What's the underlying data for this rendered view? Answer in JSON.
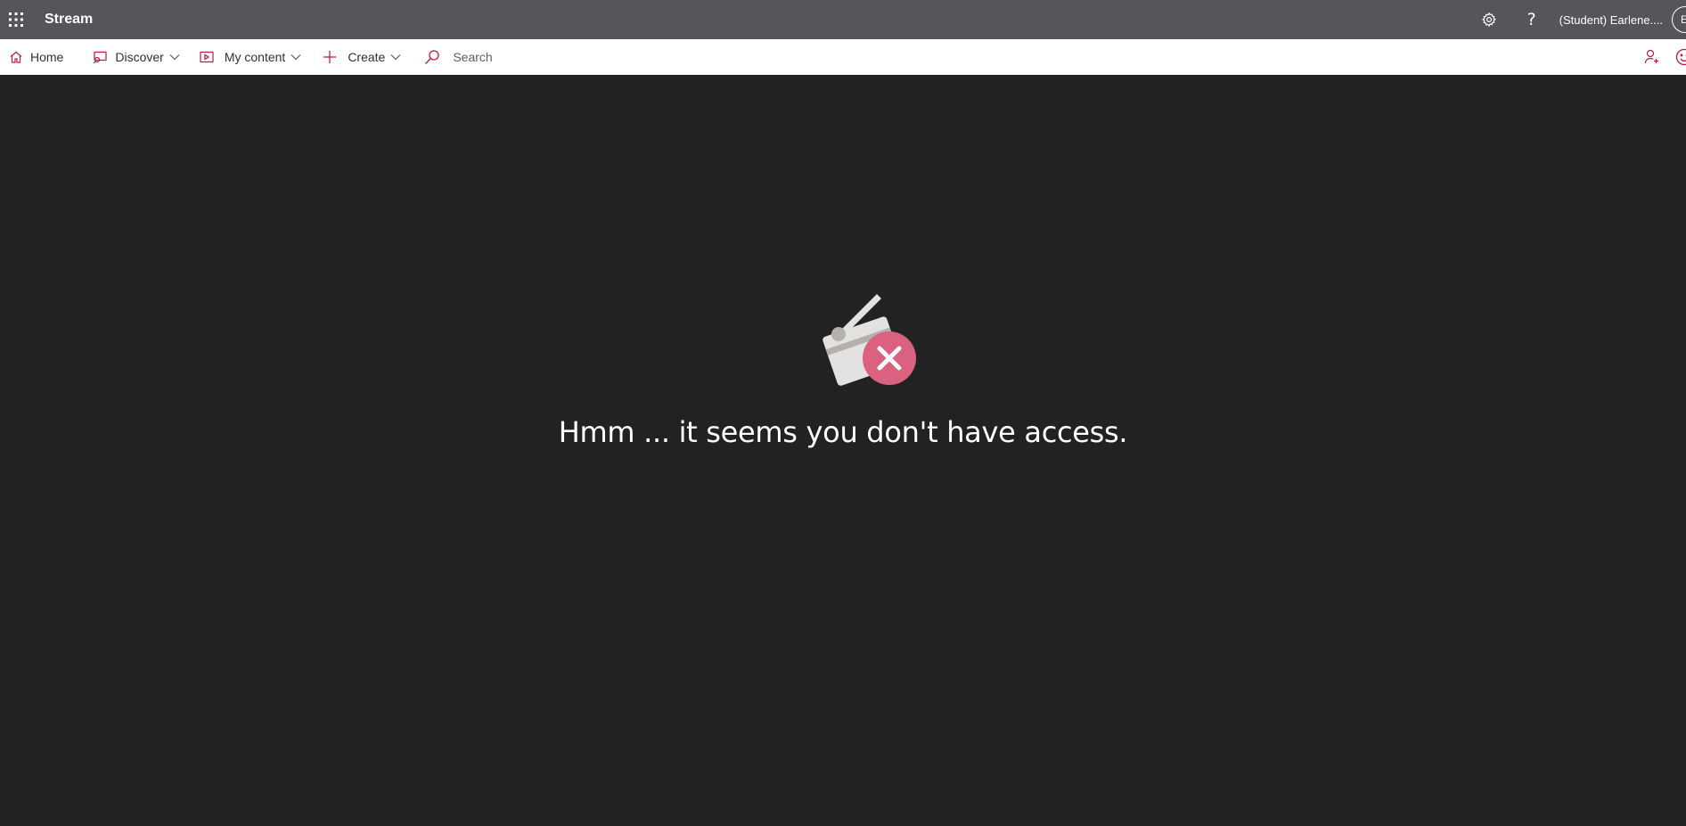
{
  "suite_bar": {
    "app_name": "Stream",
    "user_name": "(Student) Earlene....",
    "avatar_initial": "E",
    "help_glyph": "?",
    "icons": [
      "waffle-icon",
      "settings-icon",
      "help-icon"
    ]
  },
  "nav": {
    "items": [
      {
        "label": "Home",
        "icon": "home-icon",
        "has_dropdown": false
      },
      {
        "label": "Discover",
        "icon": "discover-icon",
        "has_dropdown": true
      },
      {
        "label": "My content",
        "icon": "my-content-icon",
        "has_dropdown": true
      },
      {
        "label": "Create",
        "icon": "plus-icon",
        "has_dropdown": true
      }
    ],
    "search": {
      "placeholder": "Search",
      "value": ""
    },
    "right_icons": [
      "person-add-icon",
      "feedback-smiley-icon"
    ]
  },
  "main": {
    "message": "Hmm ... it seems you don't have access.",
    "illustration": "clapperboard-denied-icon"
  },
  "colors": {
    "suite_bar_bg": "#56565a",
    "nav_bg": "#ffffff",
    "page_bg": "#222222",
    "accent": "#bc1948",
    "error_badge": "#d9587a"
  }
}
